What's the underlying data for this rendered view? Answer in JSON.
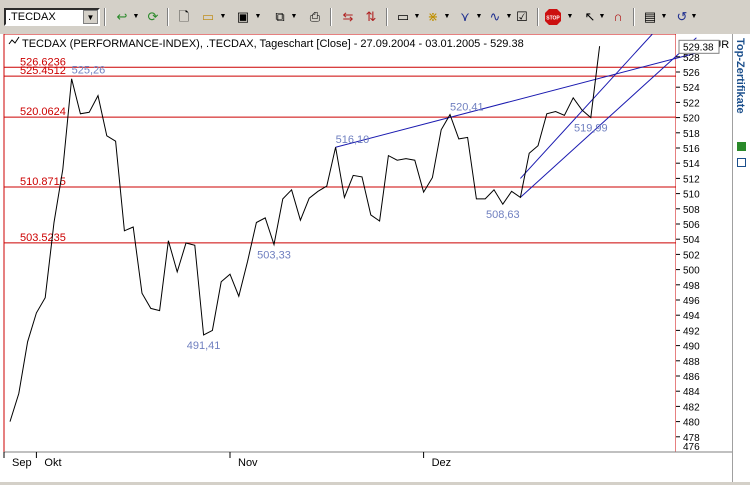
{
  "toolbar": {
    "symbol_value": ".TECDAX",
    "icons": [
      "refresh-icon",
      "reload-icon",
      "new-icon",
      "open-icon",
      "save-icon",
      "copy-icon",
      "print-icon",
      "chart-type-icon",
      "chart-zoom-icon",
      "window-icon",
      "candles-icon",
      "indicators-icon",
      "studies-icon",
      "properties-icon",
      "stop-icon",
      "pointer-icon",
      "magnet-icon",
      "screen-icon",
      "undo-icon"
    ]
  },
  "side_panel": {
    "label": "Top-Zertifikate"
  },
  "chart": {
    "title": "TECDAX (PERFORMANCE-INDEX), .TECDAX, Tageschart [Close] - 27.09.2004 - 03.01.2005 - 529.38",
    "currency": "EUR",
    "last_value": "529.38",
    "colors": {
      "price": "#000000",
      "trendline": "#1a1ab0",
      "hline": "#cc0000",
      "hlabel": "#cc0000",
      "peaklabel": "#7080c0",
      "border": "#cc0000",
      "grid": "#a0a0a0"
    }
  },
  "chart_data": {
    "type": "line",
    "ylim": [
      476,
      531
    ],
    "y_ticks": [
      478,
      480,
      482,
      484,
      486,
      488,
      490,
      492,
      494,
      496,
      498,
      500,
      502,
      504,
      506,
      508,
      510,
      512,
      514,
      516,
      518,
      520,
      522,
      524,
      526,
      528
    ],
    "y_tick_top_label": "476",
    "x_months": [
      "Sep",
      "Okt",
      "Nov",
      "Dez"
    ],
    "series": [
      {
        "values": [
          480.0,
          483.7,
          490.5,
          494.3,
          496.3,
          506.2,
          513.2,
          525.1,
          520.5,
          520.7,
          522.9,
          517.6,
          516.9,
          505.1,
          505.6,
          496.9,
          494.9,
          494.6,
          503.8,
          499.7,
          503.5,
          503.2,
          491.4,
          492.0,
          498.4,
          499.4,
          496.5,
          501.1,
          506.2,
          506.8,
          503.3,
          509.3,
          510.5,
          506.5,
          509.4,
          510.3,
          511.0,
          516.1,
          509.5,
          512.4,
          512.2,
          507.2,
          506.4,
          515.0,
          514.4,
          514.6,
          514.4,
          510.2,
          512.1,
          518.4,
          520.4,
          517.2,
          517.4,
          509.3,
          509.3,
          510.5,
          508.6,
          510.3,
          509.5,
          515.3,
          516.3,
          520.5,
          520.8,
          520.3,
          522.6,
          521.0,
          520.0,
          529.4
        ]
      }
    ],
    "horizontal_lines": [
      {
        "label": "526.6236",
        "value": 526.6236
      },
      {
        "label": "525.4512",
        "value": 525.4512
      },
      {
        "label": "520.0624",
        "value": 520.0624
      },
      {
        "label": "510.8715",
        "value": 510.8715
      },
      {
        "label": "503.5235",
        "value": 503.5235
      }
    ],
    "annotations": [
      {
        "text": "525,26",
        "x": 7,
        "y": 525.26
      },
      {
        "text": "516,10",
        "x": 37,
        "y": 516.1
      },
      {
        "text": "520,41",
        "x": 50,
        "y": 520.41
      },
      {
        "text": "491,41",
        "x": 22,
        "y": 491.41
      },
      {
        "text": "503,33",
        "x": 30,
        "y": 503.33
      },
      {
        "text": "508,63",
        "x": 56,
        "y": 508.63
      },
      {
        "text": "519,99",
        "x": 66,
        "y": 519.99
      }
    ],
    "trendlines": [
      {
        "x1": 37,
        "y1": 516.1,
        "x2": 78,
        "y2": 528.5
      },
      {
        "x1": 58,
        "y1": 509.5,
        "x2": 78,
        "y2": 530.5
      },
      {
        "x1": 58,
        "y1": 512.0,
        "x2": 73,
        "y2": 531.0
      }
    ]
  }
}
